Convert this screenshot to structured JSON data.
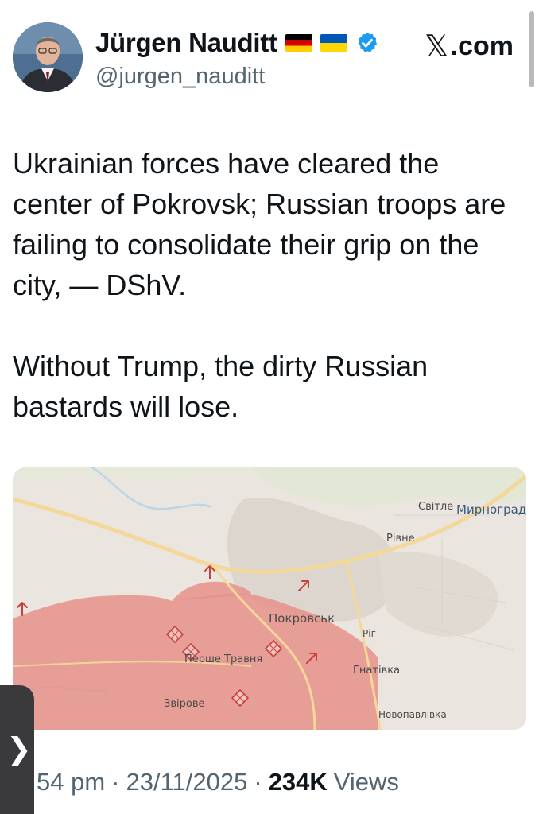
{
  "author": {
    "display_name": "Jürgen Nauditt",
    "handle": "@jurgen_nauditt",
    "flags": [
      "germany-flag-icon",
      "ukraine-flag-icon"
    ],
    "verified": true
  },
  "brand": {
    "label": ".com",
    "icon": "x-logo-icon"
  },
  "tweet": {
    "text": "Ukrainian forces have cleared the center of Pokrovsk; Russian troops are failing to consolidate their grip on the city, — DShV.\n\nWithout Trump, the dirty Russian bastards will lose."
  },
  "map": {
    "labels": {
      "svitle": "Світле",
      "myrnohrad": "Мирноград",
      "rivne": "Рівне",
      "pokrovsk": "Покровськ",
      "rih": "Рiг",
      "hnativka": "Гнатівка",
      "pershe_travnia": "Перше Травня",
      "zvirove": "Звірове",
      "novopavlivka": "Новопавлівка"
    },
    "colors": {
      "background": "#eae6df",
      "occupied": "#e6918a",
      "road": "#f3d89a",
      "water": "#b8d6e8",
      "marker": "#d9534f"
    }
  },
  "meta": {
    "time": "54 pm",
    "date": "23/11/2025",
    "views_count": "234K",
    "views_label": "Views",
    "separator": "·"
  },
  "ui": {
    "side_handle_glyph": "❯"
  }
}
